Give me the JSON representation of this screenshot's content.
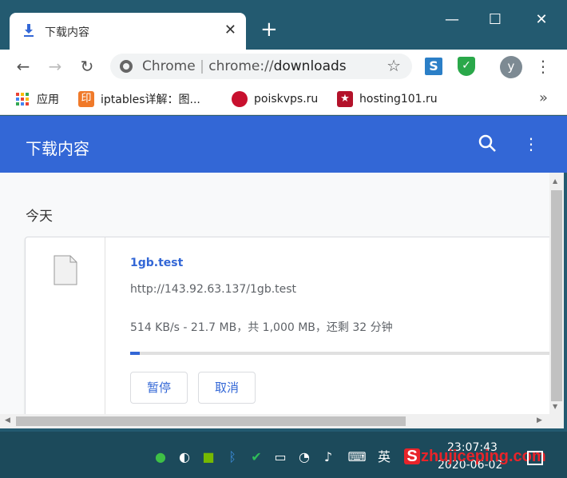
{
  "tab": {
    "title": "下载内容",
    "icon": "download-icon"
  },
  "window_controls": {
    "minimize": "—",
    "maximize": "☐",
    "close": "✕"
  },
  "toolbar": {
    "url_scheme_label": "Chrome",
    "url_separator": "|",
    "url_prefix": "chrome://",
    "url_host": "downloads",
    "avatar_letter": "y"
  },
  "bookmarks": [
    {
      "label": "应用",
      "icon": "apps-grid-icon"
    },
    {
      "label": "iptables详解：图...",
      "icon": "印",
      "color": "#f07a2a"
    },
    {
      "label": "poiskvps.ru",
      "icon": "poiskvps-icon",
      "color": "#c8102e"
    },
    {
      "label": "hosting101.ru",
      "icon": "star-icon",
      "color": "#b3122a"
    }
  ],
  "header": {
    "title": "下载内容"
  },
  "downloads": {
    "date": "今天",
    "item": {
      "filename": "1gb.test",
      "url": "http://143.92.63.137/1gb.test",
      "status": "514 KB/s - 21.7 MB，共 1,000 MB，还剩 32 分钟",
      "progress_fraction": 0.0217,
      "pause_label": "暂停",
      "cancel_label": "取消"
    }
  },
  "taskbar": {
    "time": "23:07:43",
    "date": "2020-06-02",
    "ime": "英",
    "watermark_text": "zhujiceping.com",
    "watermark_letter": "S"
  },
  "colors": {
    "accent": "#3367d6",
    "frame": "#235a70"
  }
}
